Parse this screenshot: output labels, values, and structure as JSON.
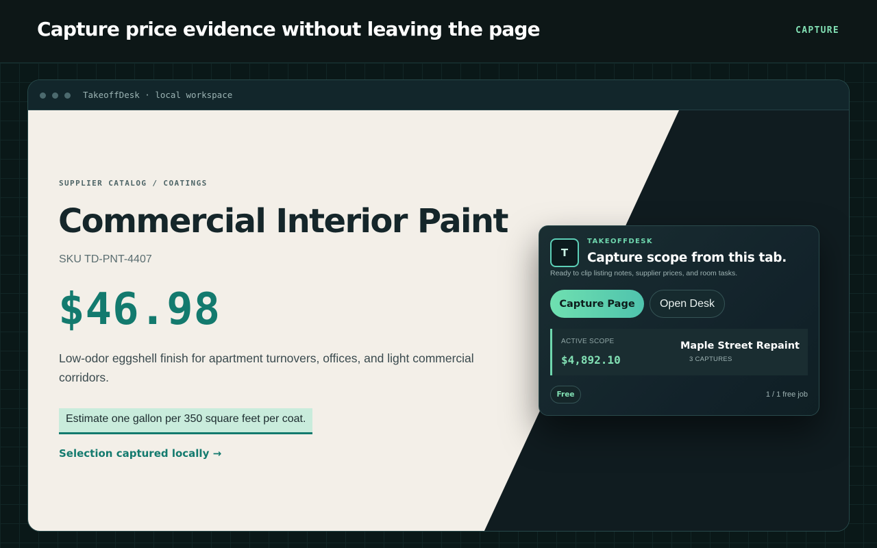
{
  "header": {
    "headline": "Capture price evidence without leaving the page",
    "nav_label": "CAPTURE"
  },
  "window": {
    "title": "TakeoffDesk · local workspace"
  },
  "product": {
    "breadcrumb": "SUPPLIER CATALOG / COATINGS",
    "title": "Commercial Interior Paint",
    "sku": "SKU TD-PNT-4407",
    "price": "$46.98",
    "description": "Low-odor eggshell finish for apartment turnovers, offices, and light commercial corridors.",
    "highlight": "Estimate one gallon per 350 square feet per coat.",
    "selection_link": "Selection captured locally →"
  },
  "panel": {
    "logo_letter": "T",
    "brand": "TAKEOFFDESK",
    "tagline": "Capture scope from this tab.",
    "subtitle": "Ready to clip listing notes, supplier prices, and room tasks.",
    "capture_button": "Capture Page",
    "open_button": "Open Desk",
    "scope_label": "ACTIVE SCOPE",
    "scope_value": "$4,892.10",
    "scope_name": "Maple Street Repaint",
    "scope_count": "3 CAPTURES",
    "plan_badge": "Free",
    "usage": "1 / 1 free job"
  },
  "colors": {
    "accent": "#137a6e",
    "accent_light": "#82e0b4",
    "highlight_bg": "#c9ecdc",
    "dark_bg": "#0b1a1a",
    "paper_bg": "#f3efe8"
  }
}
